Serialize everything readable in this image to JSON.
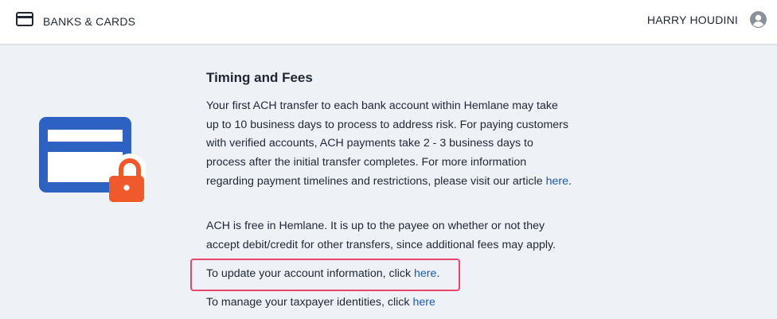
{
  "header": {
    "nav_label": "BANKS & CARDS",
    "user_name": "HARRY HOUDINI"
  },
  "section": {
    "title": "Timing and Fees",
    "p1_text": "Your first ACH transfer to each bank account within Hemlane may take up to 10 business days to process to address risk. For paying customers with verified accounts, ACH payments take 2 - 3 business days to process after the initial transfer completes. For more information regarding payment timelines and restrictions, please visit our article ",
    "p1_link": "here",
    "p1_end": ".",
    "p2_text": "ACH is free in Hemlane. It is up to the payee on whether or not they accept debit/credit for other transfers, since additional fees may apply.",
    "p3_text": "To update your account information, click ",
    "p3_link": "here",
    "p3_end": ".",
    "p4_text": "To manage your taxpayer identities, click ",
    "p4_link": "here"
  },
  "colors": {
    "card_blue": "#2d62c3",
    "lock_orange": "#f0592b",
    "link_blue": "#1a5bb8",
    "highlight_pink": "#e8456e",
    "background": "#eef2f7"
  }
}
